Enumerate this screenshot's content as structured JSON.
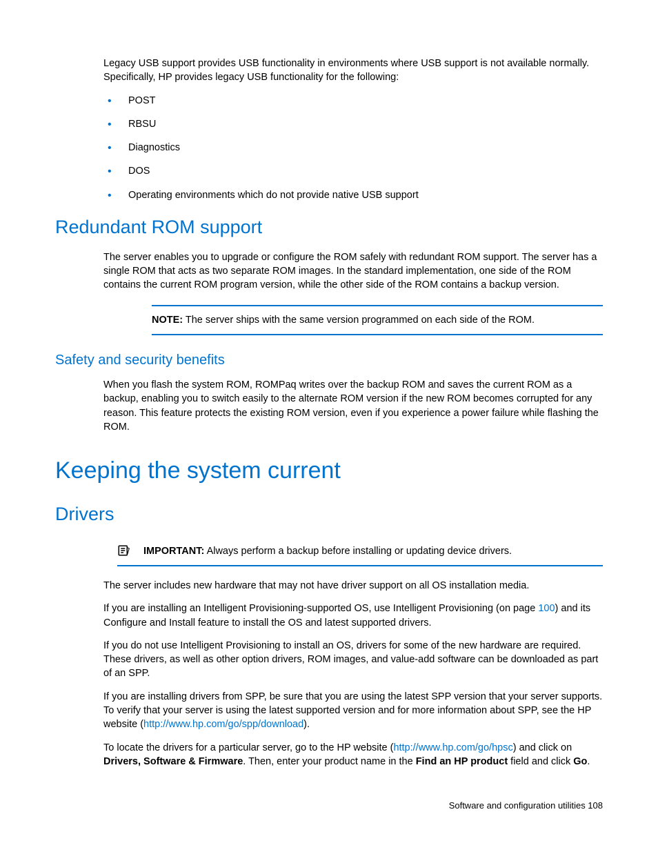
{
  "intro": {
    "para": "Legacy USB support provides USB functionality in environments where USB support is not available normally. Specifically, HP provides legacy USB functionality for the following:",
    "bullets": [
      "POST",
      "RBSU",
      "Diagnostics",
      "DOS",
      "Operating environments which do not provide native USB support"
    ]
  },
  "section1": {
    "heading": "Redundant ROM support",
    "para": "The server enables you to upgrade or configure the ROM safely with redundant ROM support. The server has a single ROM that acts as two separate ROM images. In the standard implementation, one side of the ROM contains the current ROM program version, while the other side of the ROM contains a backup version.",
    "note_label": "NOTE:",
    "note_text": "  The server ships with the same version programmed on each side of the ROM."
  },
  "section2": {
    "heading": "Safety and security benefits",
    "para": "When you flash the system ROM, ROMPaq writes over the backup ROM and saves the current ROM as a backup, enabling you to switch easily to the alternate ROM version if the new ROM becomes corrupted for any reason. This feature protects the existing ROM version, even if you experience a power failure while flashing the ROM."
  },
  "section3": {
    "heading": "Keeping the system current"
  },
  "section4": {
    "heading": "Drivers",
    "important_label": "IMPORTANT:",
    "important_text": "  Always perform a backup before installing or updating device drivers.",
    "p1": "The server includes new hardware that may not have driver support on all OS installation media.",
    "p2a": "If you are installing an Intelligent Provisioning-supported OS, use Intelligent Provisioning (on page ",
    "p2link": "100",
    "p2b": ") and its Configure and Install feature to install the OS and latest supported drivers.",
    "p3": "If you do not use Intelligent Provisioning to install an OS, drivers for some of the new hardware are required. These drivers, as well as other option drivers, ROM images, and value-add software can be downloaded as part of an SPP.",
    "p4a": "If you are installing drivers from SPP, be sure that you are using the latest SPP version that your server supports. To verify that your server is using the latest supported version and for more information about SPP, see the HP website (",
    "p4link": "http://www.hp.com/go/spp/download",
    "p4b": ").",
    "p5a": "To locate the drivers for a particular server, go to the HP website (",
    "p5link": "http://www.hp.com/go/hpsc",
    "p5b": ") and click on ",
    "p5bold1": "Drivers, Software & Firmware",
    "p5c": ". Then, enter your product name in the ",
    "p5bold2": "Find an HP product",
    "p5d": " field and click ",
    "p5bold3": "Go",
    "p5e": "."
  },
  "footer": {
    "text": "Software and configuration utilities   108"
  }
}
